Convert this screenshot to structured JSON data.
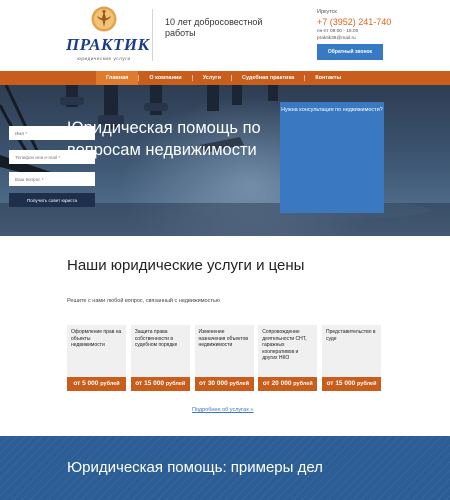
{
  "header": {
    "logo_text": "ПРАКТИК",
    "logo_subtitle": "юридические услуги",
    "tagline": "10 лет добросовестной работы",
    "city": "Иркутск",
    "phone": "+7 (3952) 241-740",
    "hours": "пн-пт 09:00 - 18:00",
    "email": "praktik38@mail.ru",
    "callback_label": "Обратный звонок"
  },
  "nav": {
    "items": [
      {
        "label": "Главная"
      },
      {
        "label": "О компании"
      },
      {
        "label": "Услуги"
      },
      {
        "label": "Судебная практика"
      },
      {
        "label": "Контакты"
      }
    ]
  },
  "hero": {
    "title": "Юридическая помощь по вопросам недвижимости"
  },
  "consult_form": {
    "title": "Нужна консультация по недвижимости?",
    "name_placeholder": "Имя *",
    "contact_placeholder": "Телефон или e-mail *",
    "question_placeholder": "Ваш вопрос *",
    "submit_label": "Получить совет юриста"
  },
  "services": {
    "title": "Наши юридические услуги и цены",
    "subtitle": "Решите с нами любой вопрос, связанный с недвижимостью",
    "cards": [
      {
        "name": "Оформление прав на объекты недвижимости",
        "price_prefix": "от",
        "price": "5 000",
        "currency": "рублей"
      },
      {
        "name": "Защита права собственности в судебном порядке",
        "price_prefix": "от",
        "price": "15 000",
        "currency": "рублей"
      },
      {
        "name": "Изменение назначения объектов недвижимости",
        "price_prefix": "от",
        "price": "30 000",
        "currency": "рублей"
      },
      {
        "name": "Сопровождение деятельности СНТ, гаражных кооперативов и других НКО",
        "price_prefix": "от",
        "price": "20 000",
        "currency": "рублей"
      },
      {
        "name": "Представительство в суде",
        "price_prefix": "от",
        "price": "15 000",
        "currency": "рублей"
      }
    ],
    "more_link": "Подробнее об услугах »"
  },
  "examples": {
    "title": "Юридическая помощь: примеры дел"
  },
  "colors": {
    "accent_orange": "#c85d1c",
    "accent_blue": "#3a78c2",
    "logo_blue": "#1d3d8c"
  },
  "icons": [
    "logo-emblem-icon"
  ]
}
